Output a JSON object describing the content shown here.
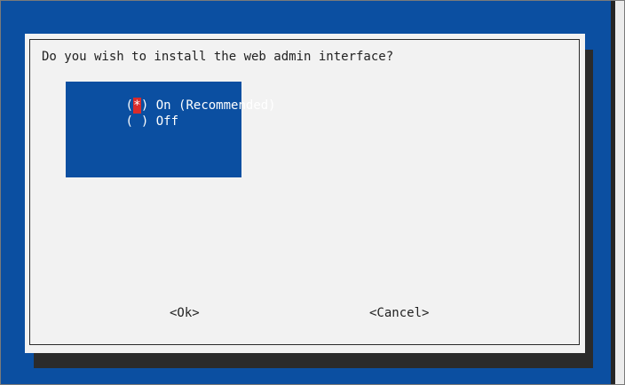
{
  "dialog": {
    "prompt": "Do you wish to install the web admin interface?"
  },
  "options": [
    {
      "open": "(",
      "mark": "*",
      "close": ")",
      "label": " On (Recommended)",
      "selected": true
    },
    {
      "open": "(",
      "mark": " ",
      "close": ")",
      "label": " Off",
      "selected": false
    }
  ],
  "buttons": {
    "ok": "<Ok>",
    "cancel": "<Cancel>"
  },
  "colors": {
    "background": "#0b4fa1",
    "dialog": "#f2f2f2",
    "list": "#0b4fa1",
    "selection_marker": "#d92b2b",
    "shadow": "#2b2b2b"
  }
}
